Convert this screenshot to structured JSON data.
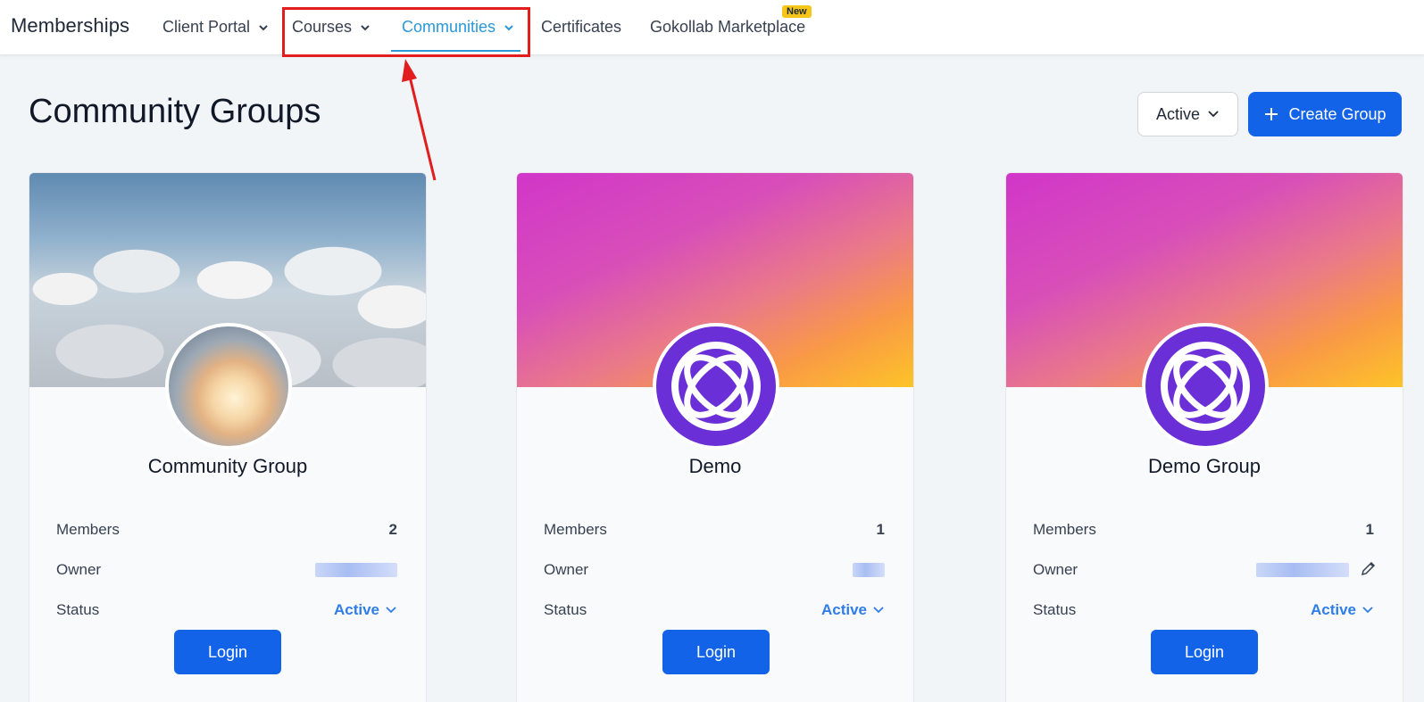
{
  "nav": {
    "brand": "Memberships",
    "items": [
      {
        "label": "Client Portal",
        "has_chevron": true
      },
      {
        "label": "Courses",
        "has_chevron": true
      },
      {
        "label": "Communities",
        "has_chevron": true,
        "active": true
      },
      {
        "label": "Certificates",
        "has_chevron": false
      },
      {
        "label": "Gokollab Marketplace",
        "has_chevron": false,
        "badge": "New"
      }
    ]
  },
  "header": {
    "title": "Community Groups",
    "filter_label": "Active",
    "create_label": "Create Group"
  },
  "cards": [
    {
      "title": "Community Group",
      "members_label": "Members",
      "members": "2",
      "owner_label": "Owner",
      "status_label": "Status",
      "status": "Active",
      "login_label": "Login",
      "cover": "clouds-photo",
      "avatar": "sky-photo"
    },
    {
      "title": "Demo",
      "members_label": "Members",
      "members": "1",
      "owner_label": "Owner",
      "status_label": "Status",
      "status": "Active",
      "login_label": "Login",
      "cover": "pink-orange-gradient",
      "avatar": "orbit-logo"
    },
    {
      "title": "Demo Group",
      "members_label": "Members",
      "members": "1",
      "owner_label": "Owner",
      "status_label": "Status",
      "status": "Active",
      "login_label": "Login",
      "cover": "pink-orange-gradient",
      "avatar": "orbit-logo",
      "owner_editable": true
    }
  ],
  "colors": {
    "accent": "#2a97d6",
    "primary_button": "#1363e8",
    "status_link": "#2f7de8",
    "annotation": "#e11d1d",
    "badge": "#f5c518"
  },
  "icons": [
    "chevron-down-icon",
    "plus-icon",
    "pencil-icon",
    "orbit-logo-icon"
  ]
}
